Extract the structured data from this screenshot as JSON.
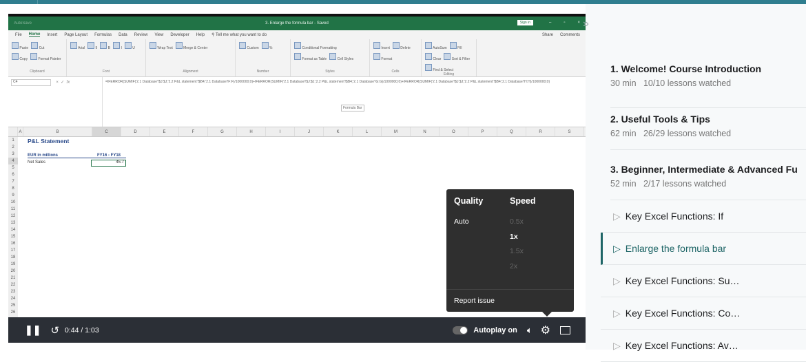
{
  "excel": {
    "window_title": "3. Enlarge the formula bar - Saved",
    "autosave": "AutoSave",
    "sign_in": "Sign in",
    "menu": [
      "File",
      "Home",
      "Insert",
      "Page Layout",
      "Formulas",
      "Data",
      "Review",
      "View",
      "Developer",
      "Help",
      "Tell me what you want to do"
    ],
    "share": "Share",
    "comments": "Comments",
    "ribbon_groups": [
      {
        "label": "Clipboard",
        "items": [
          "Paste",
          "Cut",
          "Copy",
          "Format Painter"
        ]
      },
      {
        "label": "Font",
        "items": [
          "Arial",
          "9",
          "B",
          "I",
          "U"
        ]
      },
      {
        "label": "Alignment",
        "items": [
          "Wrap Text",
          "Merge & Center"
        ]
      },
      {
        "label": "Number",
        "items": [
          "Custom",
          "%"
        ]
      },
      {
        "label": "Styles",
        "items": [
          "Conditional Formatting",
          "Format as Table",
          "Cell Styles"
        ]
      },
      {
        "label": "Cells",
        "items": [
          "Insert",
          "Delete",
          "Format"
        ]
      },
      {
        "label": "Editing",
        "items": [
          "AutoSum",
          "Fill",
          "Clear",
          "Sort & Filter",
          "Find & Select"
        ]
      }
    ],
    "name_box": "C4",
    "formula": "=IFERROR(SUMIF('2.1 Database'!$J:$J;'2.2 P&L statement'!$B4;'2.1 Database'!F:F)/1000000;0)+IFERROR(SUMIF('2.1 Database'!$J:$J;'2.2 P&L statement'!$B4;'2.1 Database'!G:G)/1000000;0)+IFERROR(SUMIF('2.1 Database'!$J:$J;'2.2 P&L statement'!$B4;'2.1 Database'!H:H)/1000000;0)",
    "formula_tooltip": "Formula Bar",
    "columns": [
      "A",
      "B",
      "C",
      "D",
      "E",
      "F",
      "G",
      "H",
      "I",
      "J",
      "K",
      "L",
      "M",
      "N",
      "O",
      "P",
      "Q",
      "R",
      "S"
    ],
    "rows": [
      "1",
      "2",
      "3",
      "4",
      "5",
      "6",
      "7",
      "8",
      "9",
      "10",
      "11",
      "12",
      "13",
      "14",
      "15",
      "16",
      "17",
      "18",
      "19",
      "20",
      "21",
      "22",
      "23",
      "24",
      "25",
      "26"
    ],
    "cells": {
      "title": "P&L Statement",
      "unit": "EUR in millions",
      "period": "FY16 - FY18",
      "row_label": "Net Sales",
      "value": "45.7"
    }
  },
  "player": {
    "time": "0:44 / 1:03",
    "autoplay": "Autoplay on",
    "settings": {
      "quality_label": "Quality",
      "speed_label": "Speed",
      "quality": "Auto",
      "speeds": [
        "0.5x",
        "1x",
        "1.5x",
        "2x"
      ],
      "selected_speed": "1x",
      "report": "Report issue"
    }
  },
  "sidebar": {
    "sections": [
      {
        "title": "1. Welcome! Course Introduction",
        "duration": "30 min",
        "progress": "10/10 lessons watched"
      },
      {
        "title": "2. Useful Tools & Tips",
        "duration": "62 min",
        "progress": "26/29 lessons watched"
      },
      {
        "title": "3. Beginner, Intermediate & Advanced Fu",
        "duration": "52 min",
        "progress": "2/17 lessons watched"
      }
    ],
    "lessons": [
      "Key Excel Functions: If",
      "Enlarge the formula bar",
      "Key Excel Functions: Su…",
      "Key Excel Functions: Co…",
      "Key Excel Functions: Av…"
    ],
    "active_lesson": 1,
    "accent": "#1e6566"
  }
}
